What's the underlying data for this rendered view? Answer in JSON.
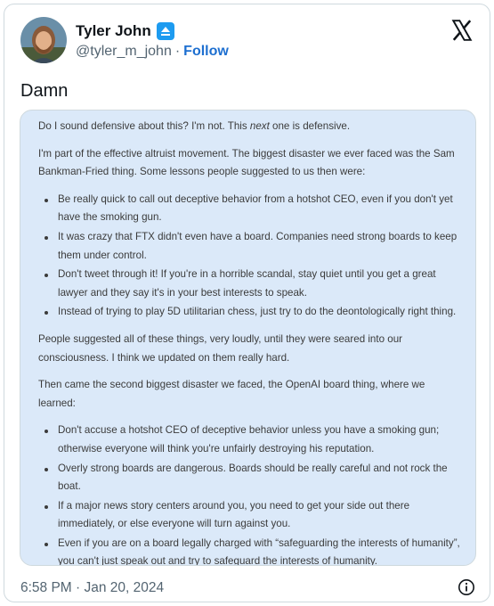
{
  "author": {
    "display_name": "Tyler John",
    "handle": "@tyler_m_john",
    "separator": "·",
    "follow_label": "Follow",
    "avatar_icon": "profile-photo",
    "badge_icon": "eject-badge-icon"
  },
  "platform_icon": "x-logo-icon",
  "tweet": {
    "text": "Damn"
  },
  "document": {
    "line1_before": "Do I sound defensive about this? I'm not. This ",
    "line1_italic": "next",
    "line1_after": " one is defensive.",
    "intro": "I'm part of the effective altruist movement. The biggest disaster we ever faced was the Sam Bankman-Fried thing. Some lessons people suggested to us then were:",
    "lessons": [
      "Be really quick to call out deceptive behavior from a hotshot CEO, even if you don't yet have the smoking gun.",
      "It was crazy that FTX didn't even have a board. Companies need strong boards to keep them under control.",
      "Don't tweet through it! If you're in a horrible scandal, stay quiet until you get a great lawyer and they say it's in your best interests to speak.",
      "Instead of trying to play 5D utilitarian chess, just try to do the deontologically right thing."
    ],
    "middle": "People suggested all of these things, very loudly, until they were seared into our consciousness. I think we updated on them really hard.",
    "second_intro": "Then came the second biggest disaster we faced, the OpenAI board thing, where we learned:",
    "learned": [
      "Don't accuse a hotshot CEO of deceptive behavior unless you have a smoking gun; otherwise everyone will think you're unfairly destroying his reputation.",
      "Overly strong boards are dangerous. Boards should be really careful and not rock the boat.",
      "If a major news story centers around you, you need to get your side out there immediately, or else everyone will turn against you.",
      "Even if you are on a board legally charged with “safeguarding the interests of humanity”, you can't just speak out and try to safeguard the interests of humanity."
    ]
  },
  "footer": {
    "timestamp": "6:58 PM · Jan 20, 2024",
    "info_icon": "info-icon"
  },
  "colors": {
    "accent": "#1d6fd0",
    "media_bg": "#dbe9f9",
    "border": "#cfd9de",
    "muted": "#536471"
  }
}
